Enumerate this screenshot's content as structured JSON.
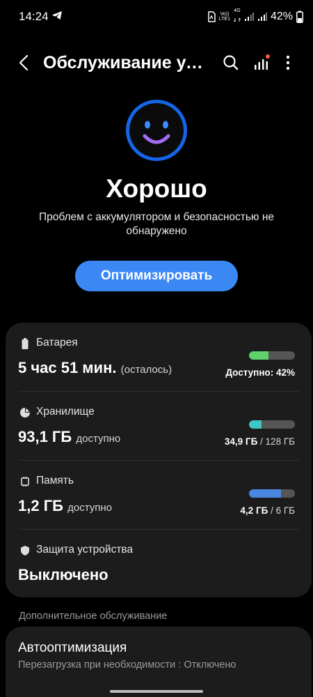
{
  "status_bar": {
    "time": "14:24",
    "network_top": "Vo))",
    "network_bottom": "LTE1",
    "network_gen": "4G",
    "battery": "42%"
  },
  "app_bar": {
    "title": "Обслуживание устройства"
  },
  "hero": {
    "status": "Хорошо",
    "description": "Проблем с аккумулятором и безопасностью не обнаружено",
    "optimize_label": "Оптимизировать",
    "accent_color": "#3b88f5"
  },
  "battery": {
    "label": "Батарея",
    "value": "5 час 51 мин.",
    "suffix": "(осталось)",
    "avail_label": "Доступно: 42%",
    "level": 0.42,
    "color": "#5fd06a"
  },
  "storage": {
    "label": "Хранилище",
    "value": "93,1 ГБ",
    "suffix": "доступно",
    "used": "34,9 ГБ",
    "total": "/ 128 ГБ",
    "level": 0.27,
    "color": "#3ec6c3"
  },
  "memory": {
    "label": "Память",
    "value": "1,2 ГБ",
    "suffix": "доступно",
    "used": "4,2 ГБ",
    "total": "/ 6 ГБ",
    "level": 0.7,
    "color": "#4a86e0"
  },
  "protection": {
    "label": "Защита устройства",
    "value": "Выключено"
  },
  "extra": {
    "header": "Дополнительное обслуживание",
    "auto_title": "Автооптимизация",
    "auto_sub": "Перезагрузка при необходимости : Отключено"
  }
}
